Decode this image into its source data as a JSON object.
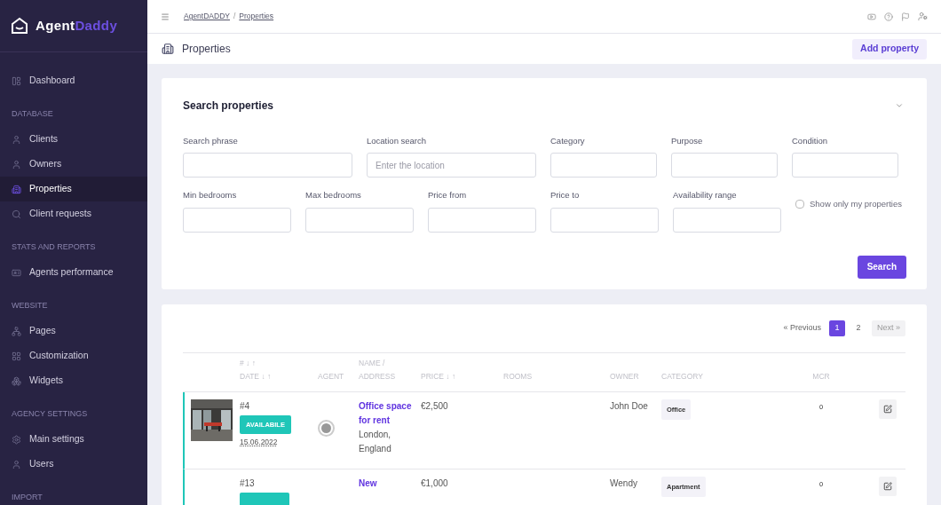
{
  "brand": {
    "first": "Agent",
    "second": "Daddy"
  },
  "sidebar": {
    "items": [
      {
        "kind": "link",
        "label": "Dashboard",
        "selected": false
      },
      {
        "kind": "section",
        "label": "DATABASE"
      },
      {
        "kind": "link",
        "label": "Clients",
        "selected": false
      },
      {
        "kind": "link",
        "label": "Owners",
        "selected": false
      },
      {
        "kind": "link",
        "label": "Properties",
        "selected": true
      },
      {
        "kind": "link",
        "label": "Client requests",
        "selected": false
      },
      {
        "kind": "section",
        "label": "STATS AND REPORTS"
      },
      {
        "kind": "link",
        "label": "Agents performance",
        "selected": false
      },
      {
        "kind": "section",
        "label": "WEBSITE"
      },
      {
        "kind": "link",
        "label": "Pages",
        "selected": false
      },
      {
        "kind": "link",
        "label": "Customization",
        "selected": false
      },
      {
        "kind": "link",
        "label": "Widgets",
        "selected": false
      },
      {
        "kind": "section",
        "label": "AGENCY SETTINGS"
      },
      {
        "kind": "link",
        "label": "Main settings",
        "selected": false
      },
      {
        "kind": "link",
        "label": "Users",
        "selected": false
      },
      {
        "kind": "section",
        "label": "IMPORT"
      }
    ]
  },
  "breadcrumb": {
    "links": [
      "AgentDADDY",
      "Properties"
    ],
    "separator": "/"
  },
  "page_title": "Properties",
  "add_button": "Add property",
  "search": {
    "title": "Search properties",
    "fields": [
      {
        "kind": "text",
        "label": "Search phrase"
      },
      {
        "kind": "text",
        "label": "Location search",
        "placeholder": "Enter the location"
      },
      {
        "kind": "text",
        "label": "Category"
      },
      {
        "kind": "text",
        "label": "Purpose"
      },
      {
        "kind": "text",
        "label": "Condition"
      },
      {
        "kind": "text",
        "label": "Min bedrooms"
      },
      {
        "kind": "text",
        "label": "Max bedrooms"
      },
      {
        "kind": "text",
        "label": "Price from"
      },
      {
        "kind": "text",
        "label": "Price to"
      },
      {
        "kind": "text",
        "label": "Availability range"
      },
      {
        "kind": "checkbox",
        "label": "Show only my properties",
        "checked": false
      }
    ],
    "button": "Search"
  },
  "pagination": {
    "previous": "« Previous",
    "pages": [
      {
        "label": "1",
        "selected": true
      },
      {
        "label": "2",
        "selected": false
      }
    ],
    "next": "Next »"
  },
  "table": {
    "columns": [
      {
        "lines": [
          "# ↓ ↑",
          "DATE ↓ ↑"
        ]
      },
      {
        "lines": [
          "AGENT"
        ]
      },
      {
        "lines": [
          "NAME /",
          "ADDRESS"
        ]
      },
      {
        "lines": [
          "PRICE ↓ ↑"
        ]
      },
      {
        "lines": [
          "ROOMS"
        ]
      },
      {
        "lines": [
          "OWNER"
        ]
      },
      {
        "lines": [
          "CATEGORY"
        ]
      },
      {
        "lines": [
          "MCR"
        ]
      }
    ],
    "rows": [
      {
        "id": "#4",
        "status": "AVAILABILE",
        "date": "15.06.2022",
        "name": "Office space for rent",
        "address": "London, England",
        "price": "€2,500",
        "owner": "John Doe",
        "category": "Office",
        "mcr": "0",
        "photo": true,
        "agent": true
      },
      {
        "id": "#13",
        "status_badge": true,
        "name": "New",
        "price": "€1,000",
        "owner": "Wendy",
        "category": "Apartment",
        "mcr": "0",
        "photo": false,
        "agent": false
      }
    ]
  }
}
